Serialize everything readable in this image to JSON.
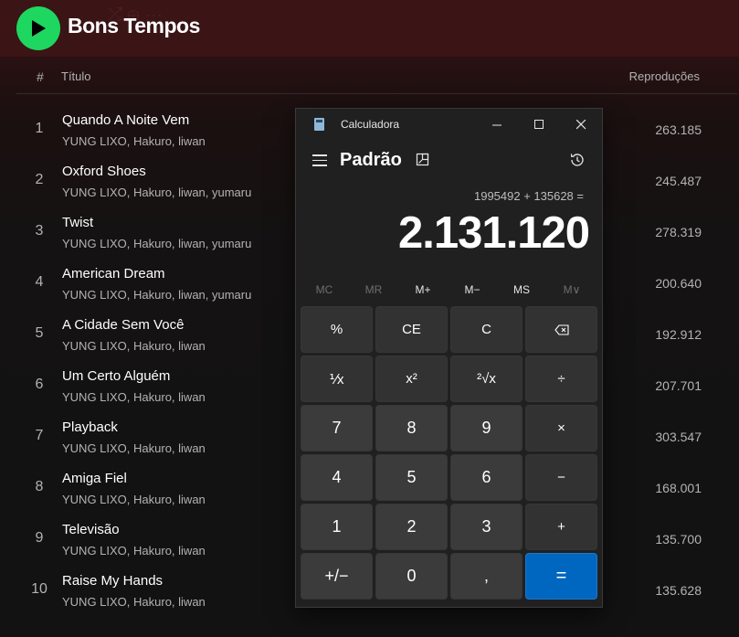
{
  "spotify": {
    "album_title": "Bons Tempos",
    "columns": {
      "hash": "#",
      "title": "Título",
      "plays": "Reproduções"
    },
    "tracks": [
      {
        "num": "1",
        "title": "Quando A Noite Vem",
        "artists": "YUNG LIXO, Hakuro, liwan",
        "plays": "263.185"
      },
      {
        "num": "2",
        "title": "Oxford Shoes",
        "artists": "YUNG LIXO, Hakuro, liwan, yumaru",
        "plays": "245.487"
      },
      {
        "num": "3",
        "title": "Twist",
        "artists": "YUNG LIXO, Hakuro, liwan, yumaru",
        "plays": "278.319"
      },
      {
        "num": "4",
        "title": "American Dream",
        "artists": "YUNG LIXO, Hakuro, liwan, yumaru",
        "plays": "200.640"
      },
      {
        "num": "5",
        "title": "A Cidade Sem Você",
        "artists": "YUNG LIXO, Hakuro, liwan",
        "plays": "192.912"
      },
      {
        "num": "6",
        "title": "Um Certo Alguém",
        "artists": "YUNG LIXO, Hakuro, liwan",
        "plays": "207.701"
      },
      {
        "num": "7",
        "title": "Playback",
        "artists": "YUNG LIXO, Hakuro, liwan",
        "plays": "303.547"
      },
      {
        "num": "8",
        "title": "Amiga Fiel",
        "artists": "YUNG LIXO, Hakuro, liwan",
        "plays": "168.001"
      },
      {
        "num": "9",
        "title": "Televisão",
        "artists": "YUNG LIXO, Hakuro, liwan",
        "plays": "135.700"
      },
      {
        "num": "10",
        "title": "Raise My Hands",
        "artists": "YUNG LIXO, Hakuro, liwan",
        "plays": "135.628"
      }
    ]
  },
  "calculator": {
    "app_name": "Calculadora",
    "mode": "Padrão",
    "expression": "1995492 + 135628 =",
    "result": "2.131.120",
    "memory": {
      "mc": "MC",
      "mr": "MR",
      "mplus": "M+",
      "mminus": "M−",
      "ms": "MS",
      "mlist": "M∨"
    },
    "keys": {
      "percent": "%",
      "ce": "CE",
      "c": "C",
      "backspace": "⌫",
      "reciprocal": "⅟x",
      "square": "x²",
      "sqrt": "²√x",
      "divide": "÷",
      "seven": "7",
      "eight": "8",
      "nine": "9",
      "multiply": "×",
      "four": "4",
      "five": "5",
      "six": "6",
      "minus": "−",
      "one": "1",
      "two": "2",
      "three": "3",
      "plus": "+",
      "negate": "+/−",
      "zero": "0",
      "decimal": ",",
      "equals": "="
    }
  },
  "colors": {
    "spotify_green": "#1ed760",
    "calc_equals": "#0067c0",
    "calc_bg": "#202020"
  }
}
